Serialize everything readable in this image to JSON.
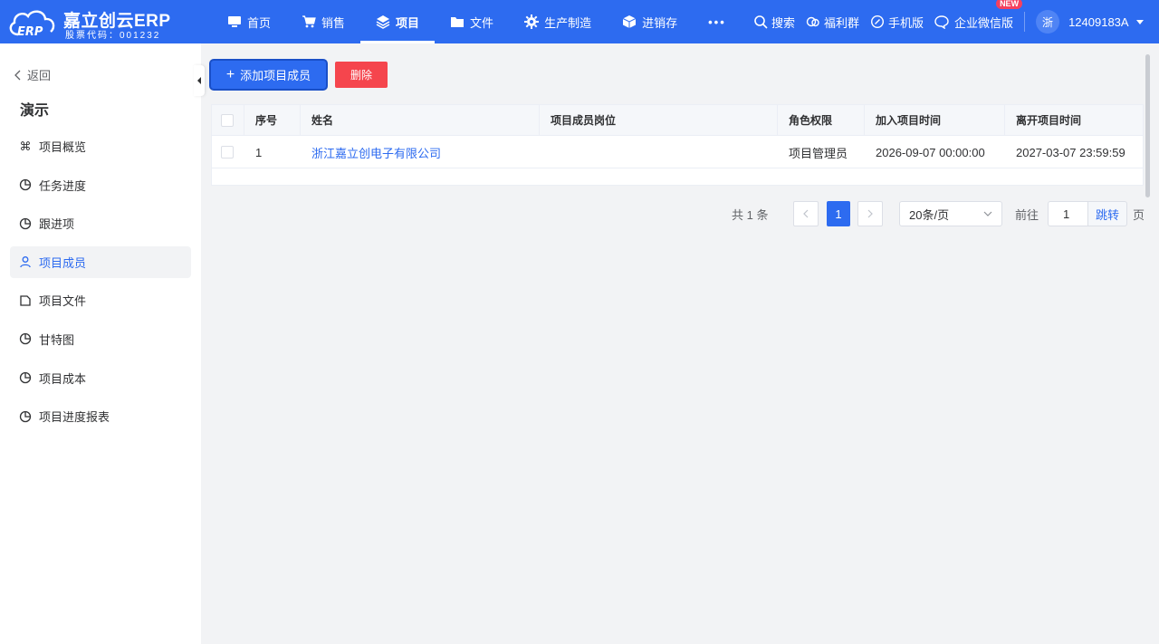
{
  "header": {
    "logo_title": "嘉立创云ERP",
    "logo_subtitle": "股票代码：001232",
    "nav": [
      {
        "label": "首页",
        "icon": "monitor-icon"
      },
      {
        "label": "销售",
        "icon": "cart-icon"
      },
      {
        "label": "项目",
        "icon": "layers-icon",
        "active": true
      },
      {
        "label": "文件",
        "icon": "folder-icon"
      },
      {
        "label": "生产制造",
        "icon": "gear-icon"
      },
      {
        "label": "进销存",
        "icon": "box-icon"
      },
      {
        "label": "•••",
        "icon": "more-icon"
      }
    ],
    "tools": {
      "search": "搜索",
      "welfare": "福利群",
      "mobile": "手机版",
      "wecom": "企业微信版",
      "new_badge": "NEW"
    },
    "user": {
      "avatar_text": "浙",
      "name": "12409183A"
    }
  },
  "sidebar": {
    "back_label": "返回",
    "project_title": "演示",
    "items": [
      {
        "label": "项目概览",
        "icon": "command-icon"
      },
      {
        "label": "任务进度",
        "icon": "pie-icon"
      },
      {
        "label": "跟进项",
        "icon": "pie-icon"
      },
      {
        "label": "项目成员",
        "icon": "user-icon",
        "active": true
      },
      {
        "label": "项目文件",
        "icon": "file-icon"
      },
      {
        "label": "甘特图",
        "icon": "pie-icon"
      },
      {
        "label": "项目成本",
        "icon": "pie-icon"
      },
      {
        "label": "项目进度报表",
        "icon": "pie-icon"
      }
    ]
  },
  "toolbar": {
    "add_label": "添加项目成员",
    "delete_label": "删除"
  },
  "table": {
    "columns": [
      "序号",
      "姓名",
      "项目成员岗位",
      "角色权限",
      "加入项目时间",
      "离开项目时间"
    ],
    "rows": [
      {
        "index": "1",
        "name": "浙江嘉立创电子有限公司",
        "position": "",
        "role": "项目管理员",
        "join_time": "2026-09-07 00:00:00",
        "leave_time": "2027-03-07 23:59:59"
      }
    ]
  },
  "pagination": {
    "total_text": "共 1 条",
    "current_page": "1",
    "page_size": "20条/页",
    "goto_label": "前往",
    "goto_value": "1",
    "goto_button": "跳转",
    "page_unit": "页"
  },
  "colors": {
    "primary": "#2d6bf0",
    "danger": "#f5454d",
    "badge": "#f5405e"
  }
}
